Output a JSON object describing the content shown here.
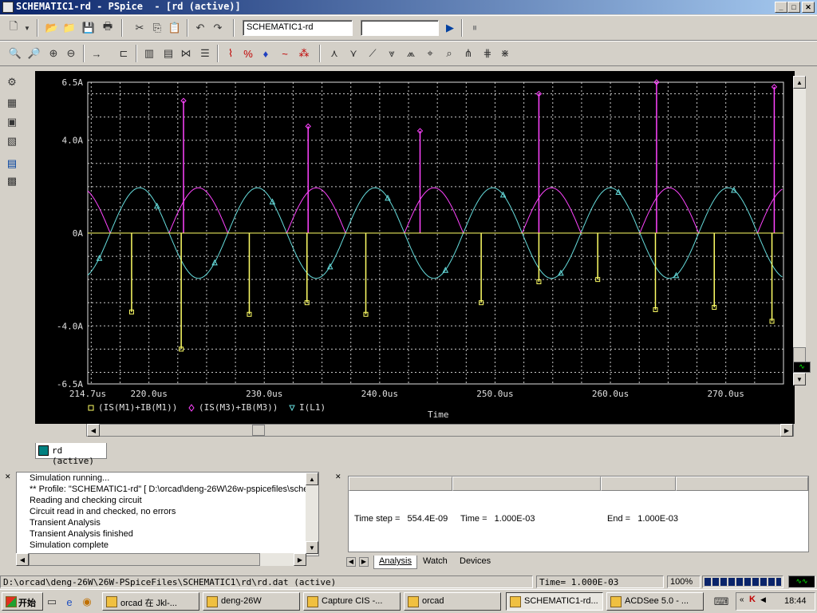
{
  "window": {
    "title": "SCHEMATIC1-rd - PSpice  - [rd (active)]"
  },
  "toolbar": {
    "profile_value": "SCHEMATIC1-rd",
    "second_combo_value": ""
  },
  "chart_data": {
    "type": "line",
    "xlabel": "Time",
    "ylabel": "",
    "xlim": [
      214.7,
      275.0
    ],
    "ylim": [
      -6.5,
      6.5
    ],
    "grid": true,
    "x_ticks": [
      "214.7us",
      "220.0us",
      "230.0us",
      "240.0us",
      "250.0us",
      "260.0us",
      "270.0us"
    ],
    "y_ticks": [
      "6.5A",
      "4.0A",
      "0A",
      "-4.0A",
      "-6.5A"
    ],
    "legend_position": "bottom",
    "series": [
      {
        "name": "(IS(M1)+IB(M1))",
        "marker": "square",
        "color": "#ffff66",
        "spikes": [
          [
            218.5,
            -3.4
          ],
          [
            222.8,
            -5.0
          ],
          [
            228.7,
            -3.5
          ],
          [
            233.7,
            -3.0
          ],
          [
            238.8,
            -3.5
          ],
          [
            248.8,
            -3.0
          ],
          [
            253.8,
            -2.1
          ],
          [
            258.9,
            -2.0
          ],
          [
            263.9,
            -3.3
          ],
          [
            269.0,
            -3.2
          ],
          [
            274.0,
            -3.8
          ]
        ]
      },
      {
        "name": "(IS(M3)+IB(M3))",
        "marker": "diamond",
        "color": "#ff44ff",
        "spikes": [
          [
            223.0,
            5.7
          ],
          [
            233.8,
            4.6
          ],
          [
            243.5,
            4.4
          ],
          [
            253.8,
            6.0
          ],
          [
            264.0,
            6.5
          ],
          [
            274.2,
            6.3
          ]
        ]
      },
      {
        "name": "I(L1)",
        "marker": "triangle",
        "color": "#66dddd",
        "amplitude": 1.95,
        "period_us": 10.2
      }
    ]
  },
  "doc_tab": {
    "label": "rd (active)"
  },
  "output": {
    "lines": [
      "Simulation running...",
      "** Profile: \"SCHEMATIC1-rd\"  [ D:\\orcad\\deng-26W\\26w-pspicefiles\\sche",
      "Reading and checking circuit",
      "Circuit read in and checked, no errors",
      "Transient Analysis",
      "Transient Analysis finished",
      "Simulation complete"
    ]
  },
  "status_panel": {
    "time_step": "Time step =   554.4E-09",
    "time": "Time =   1.000E-03",
    "end": "End =   1.000E-03",
    "tabs": [
      "Analysis",
      "Watch",
      "Devices"
    ]
  },
  "statusbar": {
    "path": "D:\\orcad\\deng-26W\\26W-PSpiceFiles\\SCHEMATIC1\\rd\\rd.dat (active)",
    "time": "Time= 1.000E-03",
    "zoom": "100%",
    "progress_pct": 100
  },
  "taskbar": {
    "start": "开始",
    "clock": "18:44",
    "tasks": [
      "orcad 在 Jkl-...",
      "deng-26W",
      "Capture CIS -...",
      "orcad",
      "SCHEMATIC1-rd...",
      "ACDSee 5.0 - ..."
    ]
  },
  "colors": {
    "plot_bg": "#000000",
    "grid": "#c8c8c8",
    "titlebar": "#0a246a"
  }
}
